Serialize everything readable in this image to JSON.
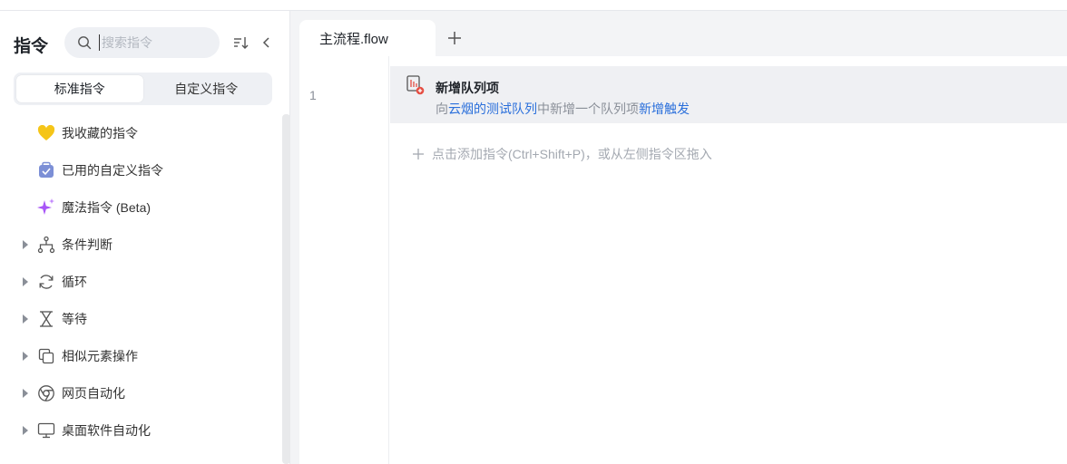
{
  "sidebar": {
    "title": "指令",
    "search": {
      "placeholder": "搜索指令",
      "value": ""
    },
    "segments": [
      {
        "label": "标准指令",
        "active": true
      },
      {
        "label": "自定义指令",
        "active": false
      }
    ],
    "items": [
      {
        "label": "我收藏的指令",
        "icon": "heart-icon",
        "expandable": false
      },
      {
        "label": "已用的自定义指令",
        "icon": "bag-icon",
        "expandable": false
      },
      {
        "label": "魔法指令 (Beta)",
        "icon": "sparkle-icon",
        "expandable": false
      },
      {
        "label": "条件判断",
        "icon": "branch-icon",
        "expandable": true
      },
      {
        "label": "循环",
        "icon": "loop-icon",
        "expandable": true
      },
      {
        "label": "等待",
        "icon": "hourglass-icon",
        "expandable": true
      },
      {
        "label": "相似元素操作",
        "icon": "copy-icon",
        "expandable": true
      },
      {
        "label": "网页自动化",
        "icon": "chrome-icon",
        "expandable": true
      },
      {
        "label": "桌面软件自动化",
        "icon": "monitor-icon",
        "expandable": true
      }
    ]
  },
  "editor": {
    "tab": {
      "label": "主流程.flow"
    },
    "steps": [
      {
        "line": "1",
        "title": "新增队列项",
        "desc_prefix": "向",
        "desc_kw1": "云烟的测试队列",
        "desc_mid": "中新增一个队列项",
        "desc_kw2": "新增触发"
      }
    ],
    "add_hint": "点击添加指令(Ctrl+Shift+P)，或从左侧指令区拖入"
  },
  "colors": {
    "accent": "#2a6fdb",
    "heart": "#f5c518",
    "bag": "#7c8fd6",
    "sparkle": "#a855f7",
    "step_icon": "#e54d42"
  }
}
